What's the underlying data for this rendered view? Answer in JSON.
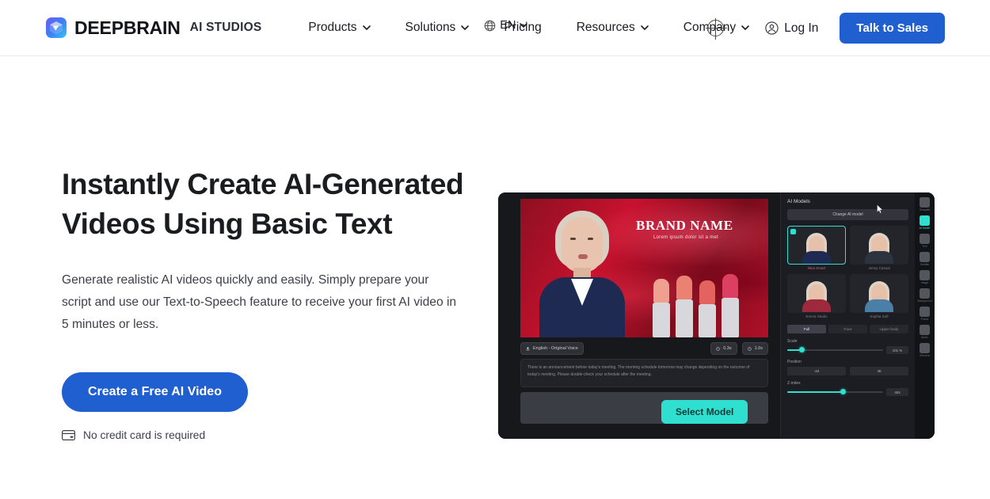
{
  "header": {
    "logo_icon": "cube-logo-icon",
    "brand_name": "DEEPBRAIN",
    "brand_sub": "AI STUDIOS",
    "nav": [
      {
        "label": "Products",
        "has_dropdown": true
      },
      {
        "label": "Solutions",
        "has_dropdown": true
      },
      {
        "label": "Pricing",
        "has_dropdown": false
      },
      {
        "label": "Resources",
        "has_dropdown": true
      },
      {
        "label": "Company",
        "has_dropdown": true
      }
    ],
    "language": {
      "icon": "globe-icon",
      "label": "EN",
      "chevron": "chevron-down-icon"
    },
    "login": {
      "icon": "user-circle-icon",
      "label": "Log In"
    },
    "cta_sales": "Talk to Sales",
    "accent_blue": "#1f5fd0"
  },
  "hero": {
    "headline": "Instantly Create AI-Generated Videos Using Basic Text",
    "subcopy": "Generate realistic AI videos quickly and easily. Simply prepare your script and use our Text-to-Speech feature to receive your first AI video in 5 minutes or less.",
    "cta_label": "Create a Free AI Video",
    "note_icon": "credit-card-icon",
    "note": "No credit card is required"
  },
  "editor": {
    "stage": {
      "brand_title": "BRAND NAME",
      "brand_subtitle": "Lorem ipsum dolor sit a met"
    },
    "voice_chip": {
      "icon": "voice-icon",
      "label": "English - Original Voice"
    },
    "time_chips": [
      {
        "icon": "clock-icon",
        "label": "0.3s"
      },
      {
        "icon": "clock-icon",
        "label": "1.0x"
      }
    ],
    "script_text": "There is an announcement before today's meeting. The morning schedule tomorrow may change depending on the outcome of today's meeting. Please double-check your schedule after the meeting.",
    "select_model_button": "Select Model",
    "panel": {
      "title": "AI Models",
      "change_button": "Change AI model",
      "models": [
        {
          "name": "Nina Smart",
          "selected": true,
          "body_color": "#1e2a52"
        },
        {
          "name": "Jenny Casual",
          "selected": false,
          "body_color": "#2e3340"
        },
        {
          "name": "Emma Studio",
          "selected": false,
          "body_color": "#9c2a3c"
        },
        {
          "name": "Sophia Soft",
          "selected": false,
          "body_color": "#4a7fa8"
        }
      ],
      "view_tabs": [
        {
          "label": "Full",
          "active": true
        },
        {
          "label": "Face",
          "active": false
        },
        {
          "label": "Upper body",
          "active": false
        }
      ],
      "scale": {
        "label": "Scale",
        "value": "101 %",
        "fill_percent": 14
      },
      "position": {
        "label": "Position",
        "x_label": "X",
        "x_value": "-24",
        "y_label": "Y",
        "y_value": "45"
      },
      "zindex": {
        "label": "Z-index",
        "value": "404",
        "fill_percent": 58
      }
    },
    "rail": [
      {
        "label": "Template",
        "icon": "template-icon",
        "active": false
      },
      {
        "label": "AI Model",
        "icon": "ai-model-icon",
        "active": true
      },
      {
        "label": "Text",
        "icon": "text-icon",
        "active": false
      },
      {
        "label": "Subtitle",
        "icon": "subtitle-icon",
        "active": false
      },
      {
        "label": "Image",
        "icon": "image-icon",
        "active": false
      },
      {
        "label": "Background",
        "icon": "background-icon",
        "active": false
      },
      {
        "label": "Frame",
        "icon": "frame-icon",
        "active": false
      },
      {
        "label": "Audio",
        "icon": "audio-icon",
        "active": false
      },
      {
        "label": "Element",
        "icon": "element-icon",
        "active": false
      }
    ]
  },
  "overlay": {
    "crosshair_cursor": "crosshair-cursor-icon",
    "mouse_pointer": "mouse-pointer-icon"
  }
}
